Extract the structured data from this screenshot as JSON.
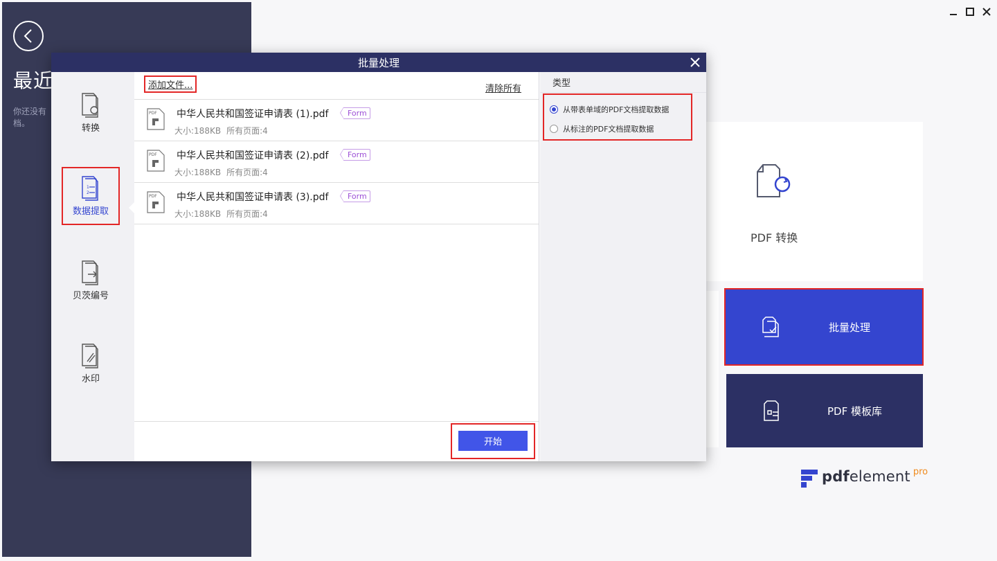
{
  "sidebar": {
    "recent_title": "最近",
    "recent_desc": "你还没有\n档。"
  },
  "window_controls": [
    "minimize",
    "maximize",
    "close"
  ],
  "home_cards": {
    "convert_label": "PDF 转换",
    "batch_label": "批量处理",
    "template_label": "PDF 模板库"
  },
  "logo": {
    "pdf": "pdf",
    "element": "element",
    "pro": "pro"
  },
  "dialog": {
    "title": "批量处理",
    "nav": [
      {
        "label": "转换",
        "icon": "convert-icon"
      },
      {
        "label": "数据提取",
        "icon": "data-extract-icon",
        "active": true
      },
      {
        "label": "贝茨编号",
        "icon": "bates-number-icon"
      },
      {
        "label": "水印",
        "icon": "watermark-icon"
      }
    ],
    "toolbar": {
      "add_files": "添加文件...",
      "clear_all": "清除所有"
    },
    "files": [
      {
        "name": "中华人民共和国签证申请表 (1).pdf",
        "tag": "Form",
        "size": "大小:188KB",
        "pages": "所有页面:4"
      },
      {
        "name": "中华人民共和国签证申请表 (2).pdf",
        "tag": "Form",
        "size": "大小:188KB",
        "pages": "所有页面:4"
      },
      {
        "name": "中华人民共和国签证申请表 (3).pdf",
        "tag": "Form",
        "size": "大小:188KB",
        "pages": "所有页面:4"
      }
    ],
    "start_label": "开始",
    "type_panel": {
      "title": "类型",
      "options": [
        {
          "label": "从带表单域的PDF文档提取数据",
          "selected": true
        },
        {
          "label": "从标注的PDF文档提取数据",
          "selected": false
        }
      ]
    }
  },
  "colors": {
    "sidebar_bg": "#373a56",
    "header_bg": "#2c3064",
    "accent_blue": "#3445cf",
    "button_blue": "#4155e8",
    "highlight_red": "#e32626",
    "form_tag": "#9c4fd6",
    "pro_orange": "#f08a1d"
  }
}
